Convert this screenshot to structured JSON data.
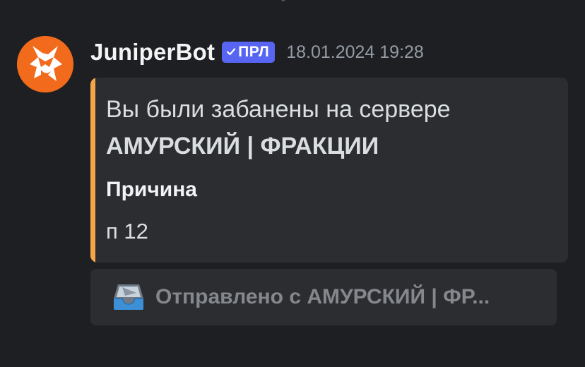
{
  "message": {
    "author": "JuniperBot",
    "bot_tag": {
      "check_icon": "checkmark-icon",
      "label": "ПРЛ"
    },
    "timestamp": "18.01.2024 19:28",
    "avatar_icon": "fox-avatar-icon"
  },
  "embed": {
    "accent_color": "#f5a448",
    "description_line1": "Вы были забанены на сервере",
    "description_line2": "АМУРСКИЙ | ФРАКЦИИ",
    "field": {
      "name": "Причина",
      "value": "п 12"
    }
  },
  "footer_button": {
    "icon": "inbox-tray-icon",
    "label": "Отправлено с АМУРСКИЙ | ФР..."
  },
  "colors": {
    "background": "#1e1f22",
    "embed_background": "#2b2d31",
    "bot_tag": "#5865f2"
  }
}
